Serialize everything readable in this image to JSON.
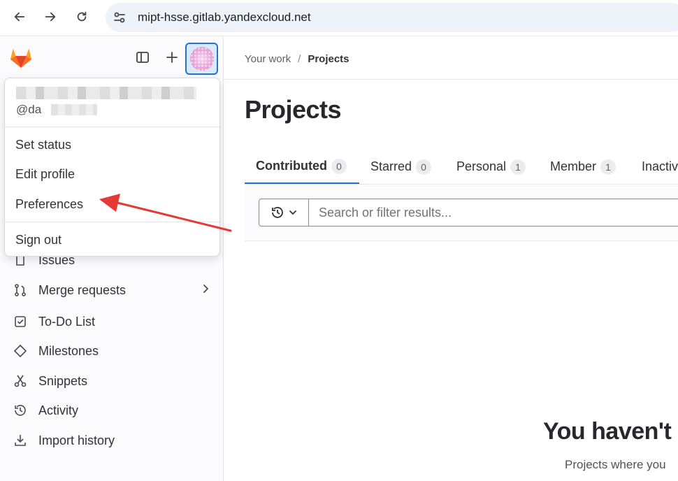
{
  "browser": {
    "url": "mipt-hsse.gitlab.yandexcloud.net"
  },
  "user_menu": {
    "handle": "@da",
    "items": [
      {
        "label": "Set status"
      },
      {
        "label": "Edit profile"
      },
      {
        "label": "Preferences"
      },
      {
        "label": "Sign out"
      }
    ]
  },
  "sidebar": {
    "items": [
      {
        "label": "Issues",
        "icon": "issues-icon"
      },
      {
        "label": "Merge requests",
        "icon": "merge-request-icon"
      },
      {
        "label": "To-Do List",
        "icon": "todo-icon"
      },
      {
        "label": "Milestones",
        "icon": "milestone-icon"
      },
      {
        "label": "Snippets",
        "icon": "snippet-icon"
      },
      {
        "label": "Activity",
        "icon": "history-icon"
      },
      {
        "label": "Import history",
        "icon": "import-icon"
      }
    ]
  },
  "breadcrumb": {
    "parent": "Your work",
    "separator": "/",
    "current": "Projects"
  },
  "page": {
    "title": "Projects"
  },
  "tabs": [
    {
      "label": "Contributed",
      "count": "0",
      "active": true
    },
    {
      "label": "Starred",
      "count": "0"
    },
    {
      "label": "Personal",
      "count": "1"
    },
    {
      "label": "Member",
      "count": "1"
    },
    {
      "label": "Inactiv"
    }
  ],
  "search": {
    "placeholder": "Search or filter results..."
  },
  "empty_state": {
    "title": "You haven't",
    "subtitle": "Projects where you"
  },
  "colors": {
    "accent": "#1f75cb",
    "arrow": "#e53935"
  }
}
